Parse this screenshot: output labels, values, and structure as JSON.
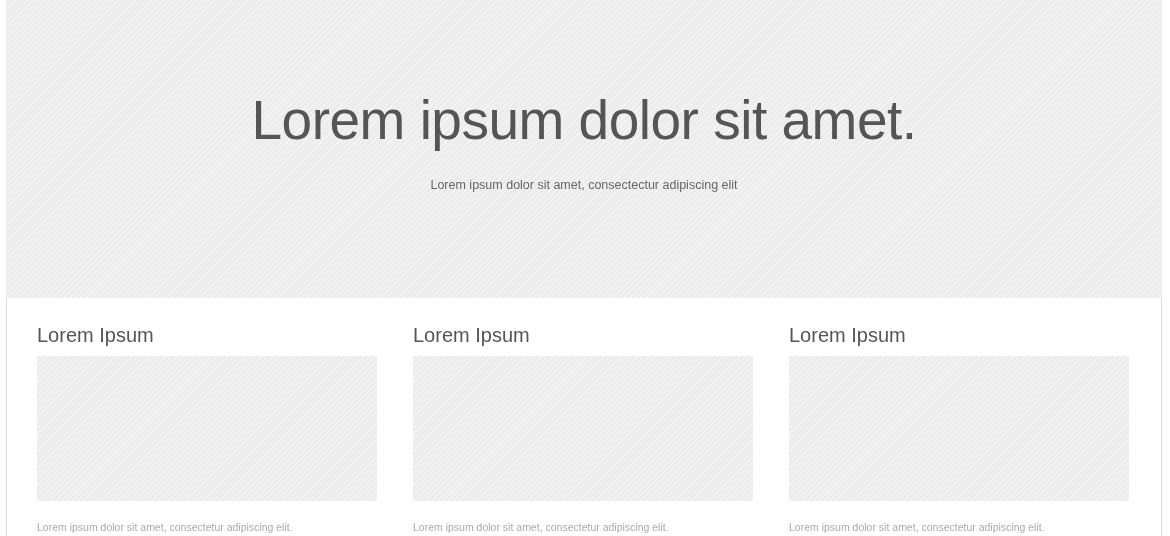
{
  "hero": {
    "title": "Lorem ipsum dolor sit amet.",
    "subtitle": "Lorem ipsum dolor sit amet, consectectur adipiscing elit"
  },
  "cards": [
    {
      "heading": "Lorem Ipsum",
      "image": {
        "kind": "placeholder"
      },
      "text": "Lorem ipsum dolor sit amet, consectetur adipiscing elit."
    },
    {
      "heading": "Lorem Ipsum",
      "image": {
        "kind": "placeholder"
      },
      "text": "Lorem ipsum dolor sit amet, consectetur adipiscing elit."
    },
    {
      "heading": "Lorem Ipsum",
      "image": {
        "kind": "placeholder"
      },
      "text": "Lorem ipsum dolor sit amet, consectetur adipiscing elit."
    }
  ]
}
